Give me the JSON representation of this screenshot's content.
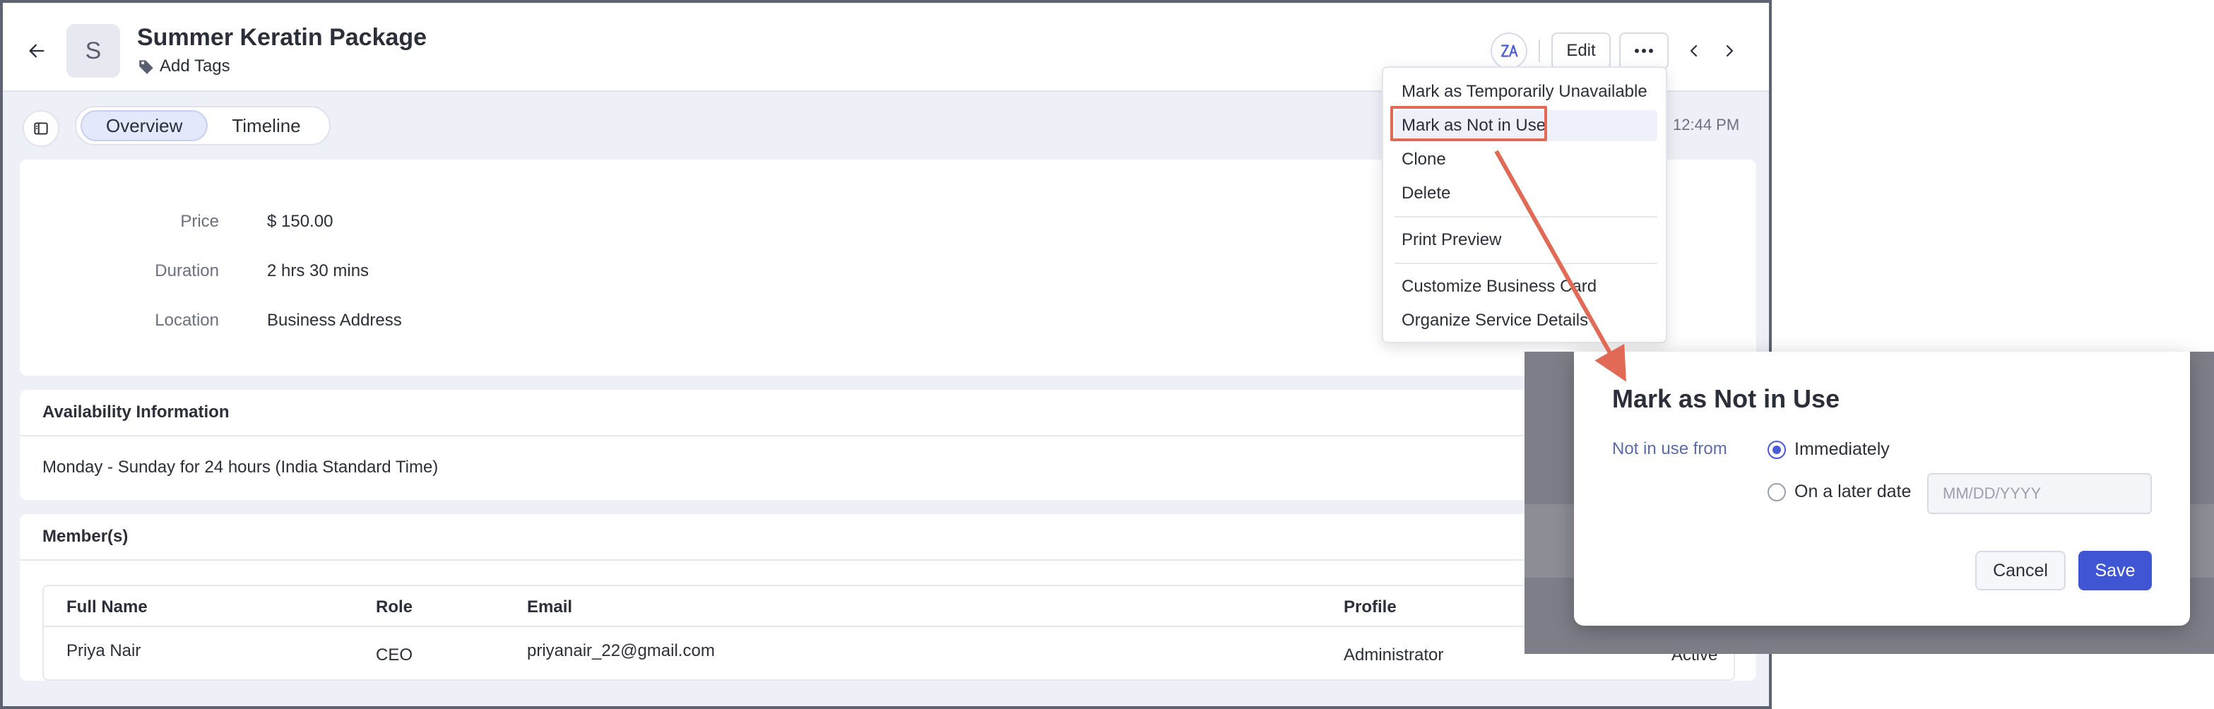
{
  "header": {
    "avatar_letter": "S",
    "title": "Summer Keratin Package",
    "add_tags": "Add Tags",
    "edit_label": "Edit"
  },
  "tabs": [
    {
      "label": "Overview",
      "active": true
    },
    {
      "label": "Timeline",
      "active": false
    }
  ],
  "modified_time": "12:44 PM",
  "details": [
    {
      "label": "Price",
      "value": "$ 150.00"
    },
    {
      "label": "Duration",
      "value": "2 hrs 30 mins"
    },
    {
      "label": "Location",
      "value": "Business Address"
    }
  ],
  "availability": {
    "title": "Availability Information",
    "text": "Monday - Sunday for 24 hours (India Standard Time)"
  },
  "members": {
    "title": "Member(s)",
    "columns": [
      "Full Name",
      "Role",
      "Email",
      "Profile"
    ],
    "rows": [
      {
        "name": "Priya Nair",
        "role": "CEO",
        "email": "priyanair_22@gmail.com",
        "profile": "Administrator",
        "status": "Active"
      }
    ]
  },
  "menu": {
    "items": [
      "Mark as Temporarily Unavailable",
      "Mark as Not in Use",
      "Clone",
      "Delete",
      "Print Preview",
      "Customize Business Card",
      "Organize Service Details"
    ]
  },
  "modal": {
    "title": "Mark as Not in Use",
    "label": "Not in use from",
    "option_immediately": "Immediately",
    "option_later": "On a later date",
    "date_placeholder": "MM/DD/YYYY",
    "cancel": "Cancel",
    "save": "Save"
  },
  "colors": {
    "accent": "#3f55d4",
    "annotation": "#e06a55"
  }
}
